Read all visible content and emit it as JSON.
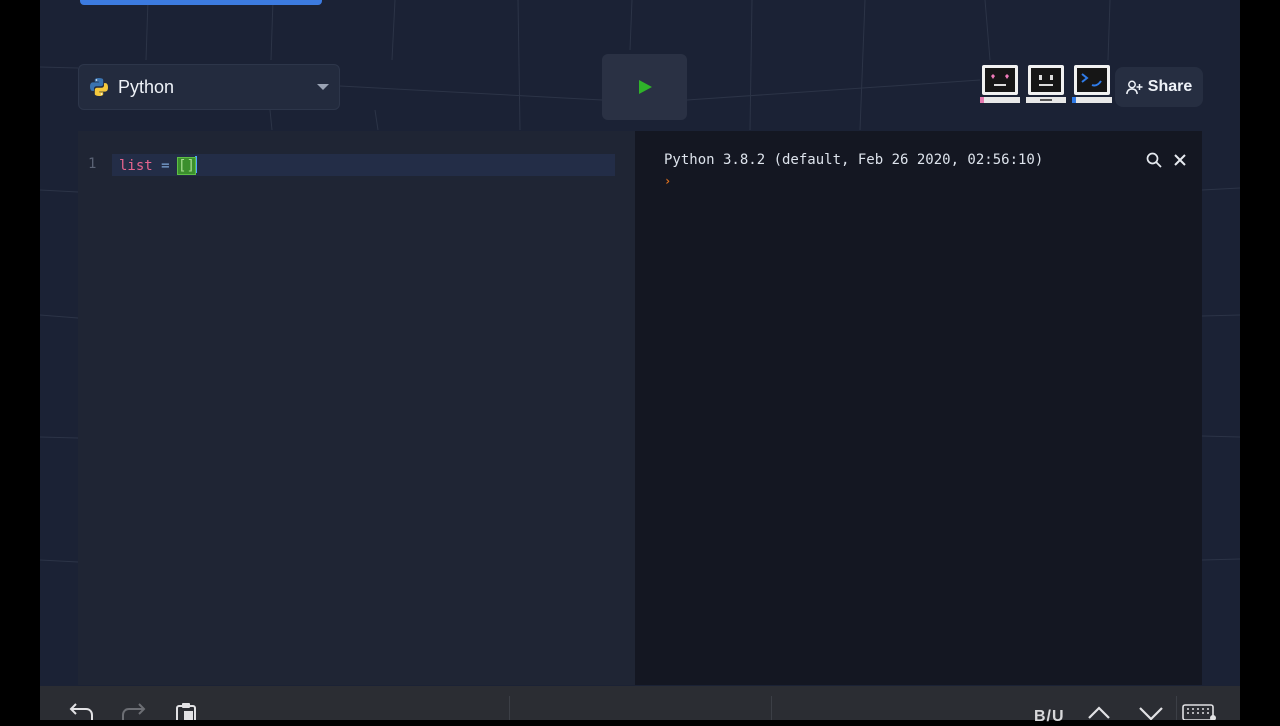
{
  "header": {
    "language": {
      "label": "Python",
      "icon": "python-logo-icon"
    },
    "run_button": {
      "icon": "play-icon",
      "color": "#2fb32a"
    },
    "collaborators": [
      {
        "name": "heart-eyes-computer-avatar"
      },
      {
        "name": "neutral-face-computer-avatar"
      },
      {
        "name": "terminal-smile-computer-avatar"
      }
    ],
    "share": {
      "label": "Share",
      "icon": "add-user-icon"
    }
  },
  "editor": {
    "line_number": "1",
    "code": {
      "identifier": "list",
      "operator": "=",
      "brackets": "[]"
    }
  },
  "console": {
    "banner": "Python 3.8.2 (default, Feb 26 2020, 02:56:10)",
    "prompt": "›"
  },
  "keyboard_toolbar": {
    "buttons": [
      "undo-icon",
      "redo-icon",
      "paste-icon",
      "format-text",
      "caret-up-icon",
      "caret-down-icon",
      "keyboard-icon"
    ],
    "format_label": "B/U"
  },
  "colors": {
    "background": "#1b2235",
    "editor_bg": "#1f2534",
    "console_bg": "#141722",
    "accent": "#3c7be0",
    "run_green": "#2fb32a"
  }
}
